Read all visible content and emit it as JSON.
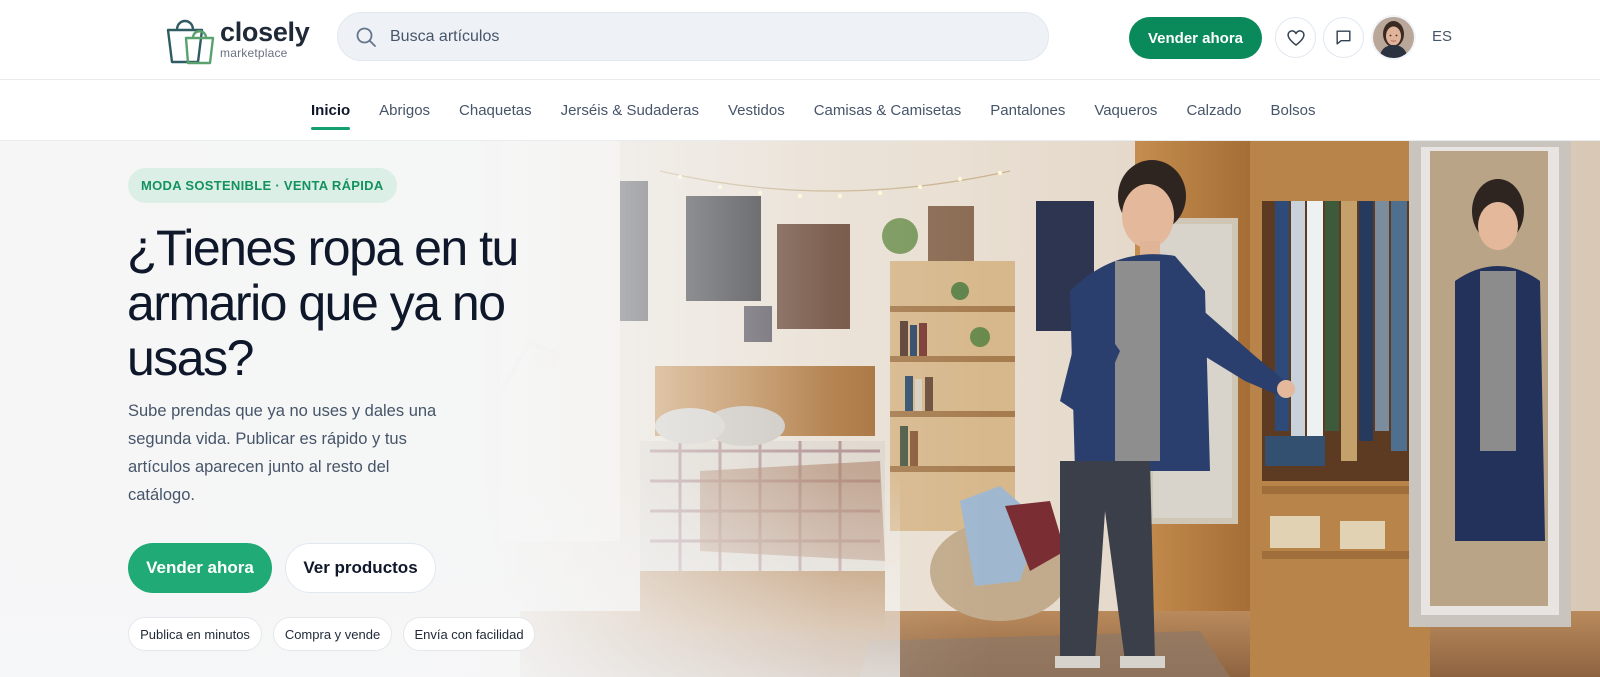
{
  "brand": {
    "name": "closely",
    "tagline": "marketplace"
  },
  "search": {
    "placeholder": "Busca artículos"
  },
  "header": {
    "sell_label": "Vender ahora",
    "language": "ES",
    "favorites_icon": "heart-icon",
    "messages_icon": "chat-icon"
  },
  "nav": {
    "items": [
      {
        "label": "Inicio",
        "active": true
      },
      {
        "label": "Abrigos"
      },
      {
        "label": "Chaquetas"
      },
      {
        "label": "Jerséis & Sudaderas"
      },
      {
        "label": "Vestidos"
      },
      {
        "label": "Camisas & Camisetas"
      },
      {
        "label": "Pantalones"
      },
      {
        "label": "Vaqueros"
      },
      {
        "label": "Calzado"
      },
      {
        "label": "Bolsos"
      }
    ]
  },
  "hero": {
    "badge": "MODA SOSTENIBLE · VENTA RÁPIDA",
    "title": "¿Tienes ropa en tu armario que ya no usas?",
    "description": "Sube prendas que ya no uses y dales una segunda vida. Publicar es rápido y tus artículos aparecen junto al resto del catálogo.",
    "primary_cta": "Vender ahora",
    "secondary_cta": "Ver productos",
    "features": [
      "Publica en minutos",
      "Compra y vende",
      "Envía con facilidad"
    ]
  },
  "colors": {
    "brand_green": "#0a8a5a",
    "cta_green": "#1faa76",
    "badge_bg": "#dcefe6",
    "text_dark": "#0f172a"
  }
}
